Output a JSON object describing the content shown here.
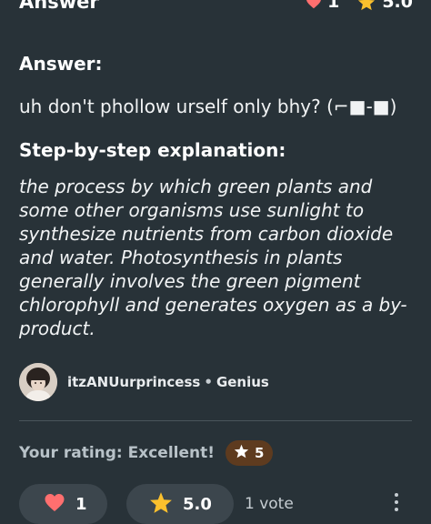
{
  "header": {
    "title": "Answer",
    "likes": "1",
    "rating": "5.0"
  },
  "answer": {
    "title": "Answer:",
    "text": "uh don't phollow urself only bhy? (⌐■-■)"
  },
  "explanation": {
    "title": "Step-by-step explanation:",
    "text": "the process by which green plants and some other organisms use sunlight to synthesize nutrients from carbon dioxide and water. Photosynthesis in plants generally involves the green pigment chlorophyll and generates oxygen as a by-product."
  },
  "author": {
    "name": "itzANUurprincess",
    "separator": "•",
    "rank": "Genius"
  },
  "your_rating": {
    "label": "Your rating: Excellent!",
    "value": "5"
  },
  "actions": {
    "thanks_count": "1",
    "rating_value": "5.0",
    "votes": "1 vote"
  },
  "colors": {
    "background": "#283238",
    "heart": "#ff6f6f",
    "star": "#fbc02d",
    "badge_bg": "#5e3b1f",
    "pill_bg": "#3c464d"
  },
  "icons": [
    "heart-icon",
    "star-icon",
    "more-options-icon"
  ]
}
